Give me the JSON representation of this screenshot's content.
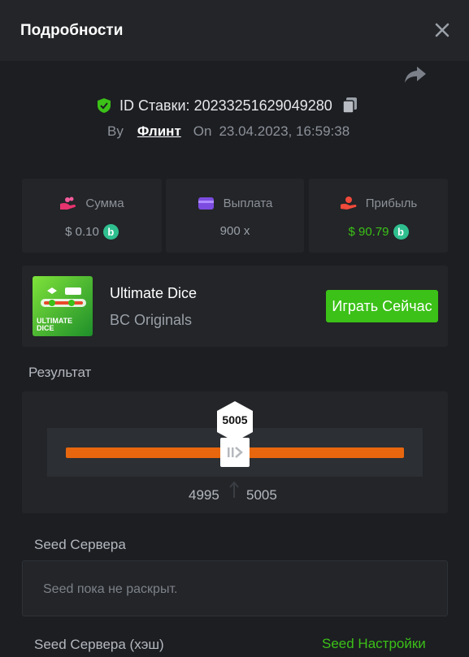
{
  "header": {
    "title": "Подробности"
  },
  "bet": {
    "id_label": "ID Ставки:",
    "id_value": "20233251629049280",
    "by_label": "By",
    "user": "Флинт",
    "on_label": "On",
    "date": "23.04.2023, 16:59:38"
  },
  "stats": {
    "amount": {
      "label": "Сумма",
      "value": "$ 0.10"
    },
    "payout": {
      "label": "Выплата",
      "value": "900 x"
    },
    "profit": {
      "label": "Прибыль",
      "value": "$ 90.79"
    }
  },
  "game": {
    "name": "Ultimate Dice",
    "provider": "BC Originals",
    "thumb_text_1": "ULTIMATE",
    "thumb_text_2": "DICE",
    "play_label": "Играть Сейчас"
  },
  "result": {
    "label": "Результат",
    "marker": "5005",
    "range_low": "4995",
    "range_high": "5005"
  },
  "seed": {
    "server_label": "Seed Сервера",
    "server_value": "Seed пока не раскрыт.",
    "hash_label": "Seed Сервера (хэш)",
    "settings_link": "Seed Настройки"
  },
  "colors": {
    "accent_green": "#3bc117",
    "track_orange": "#e8670e",
    "panel": "#232528"
  },
  "icons": [
    "close-icon",
    "share-icon",
    "shield-check-icon",
    "copy-icon",
    "coins-icon",
    "wallet-icon",
    "profit-hand-icon",
    "bc-coin-icon"
  ]
}
